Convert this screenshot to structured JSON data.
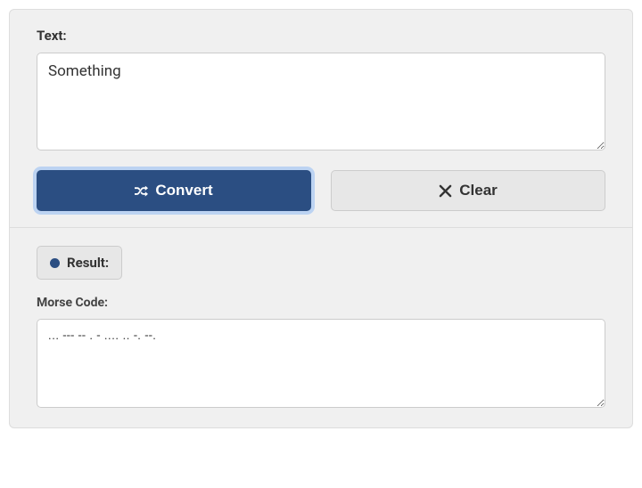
{
  "input": {
    "label": "Text:",
    "value": "Something"
  },
  "buttons": {
    "convert": "Convert",
    "clear": "Clear"
  },
  "result": {
    "badge": "Result:",
    "output_label": "Morse Code:",
    "output_value": "... --- -- . - .... .. -. --."
  }
}
